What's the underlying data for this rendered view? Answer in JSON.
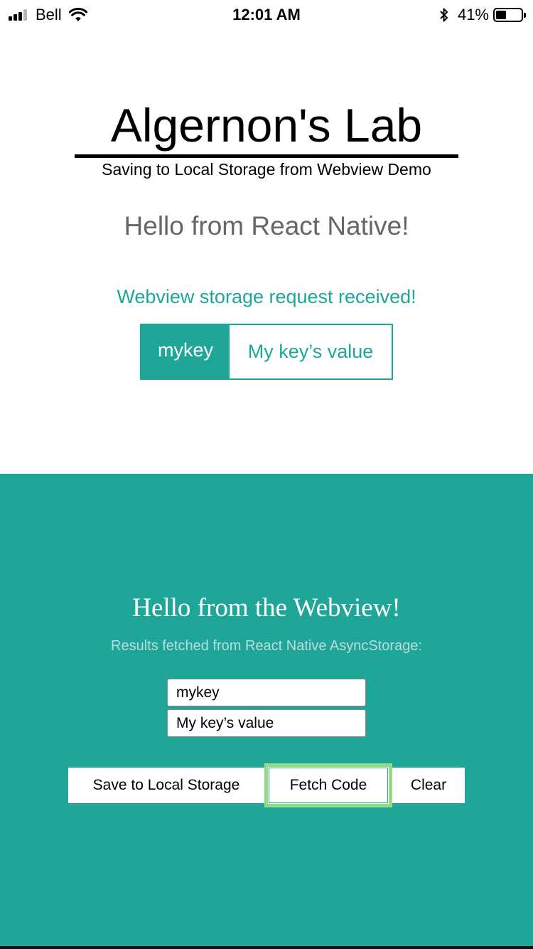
{
  "status_bar": {
    "carrier": "Bell",
    "time": "12:01 AM",
    "battery_percent": "41%",
    "battery_level": 0.41
  },
  "native": {
    "title": "Algernon's Lab",
    "subtitle": "Saving to Local Storage from Webview Demo",
    "hello": "Hello from React Native!",
    "request_message": "Webview storage request received!",
    "stored_key": "mykey",
    "stored_value": "My key’s value"
  },
  "webview": {
    "hello": "Hello from the Webview!",
    "results_label": "Results fetched from React Native AsyncStorage:",
    "key_input_value": "mykey",
    "value_input_value": "My key’s value",
    "buttons": {
      "save": "Save to Local Storage",
      "fetch": "Fetch Code",
      "clear": "Clear"
    }
  },
  "colors": {
    "accent": "#20a698",
    "focus_ring": "#95dc8a",
    "muted_text": "#666666"
  },
  "icons": {
    "signal": "cellular-signal-icon",
    "wifi": "wifi-icon",
    "bluetooth": "bluetooth-icon",
    "battery": "battery-icon"
  }
}
